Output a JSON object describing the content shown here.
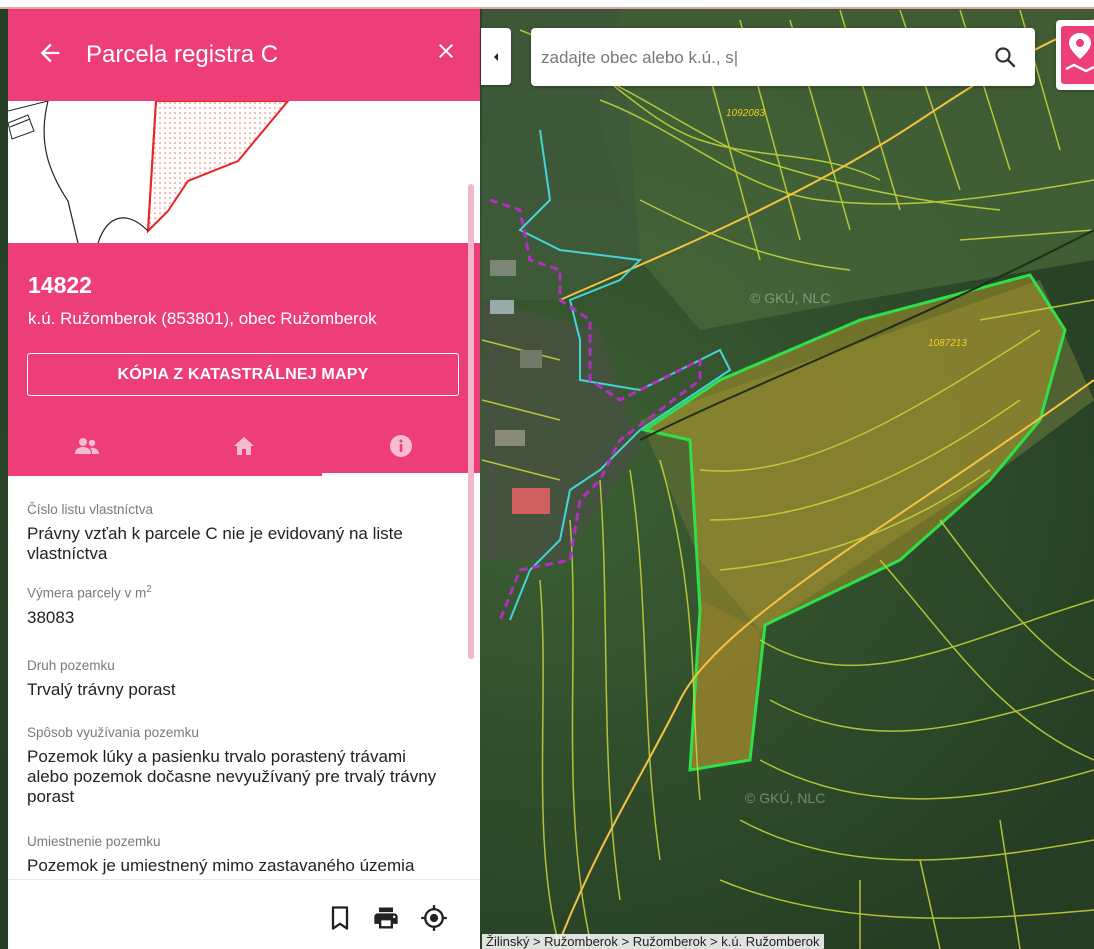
{
  "panel": {
    "title": "Parcela registra C",
    "parcel_number": "14822",
    "location": "k.ú. Ružomberok (853801), obec Ružomberok",
    "copy_button": "KÓPIA Z KATASTRÁLNEJ MAPY",
    "tabs": [
      {
        "icon": "owners-icon",
        "active": false
      },
      {
        "icon": "home-icon",
        "active": false
      },
      {
        "icon": "info-icon",
        "active": true
      }
    ],
    "fields": [
      {
        "label": "Číslo listu vlastníctva",
        "value": "Právny vzťah k parcele C nie je evidovaný na liste vlastníctva"
      },
      {
        "label": "Výmera parcely v m",
        "label_sup": "2",
        "value": "38083"
      },
      {
        "label": "Druh pozemku",
        "value": "Trvalý trávny porast"
      },
      {
        "label": "Spôsob využívania pozemku",
        "value": "Pozemok lúky a pasienku trvalo porastený trávami alebo pozemok dočasne nevyužívaný pre trvalý trávny porast"
      },
      {
        "label": "Umiestnenie pozemku",
        "value": "Pozemok je umiestnený mimo zastavaného územia obce"
      }
    ],
    "footer_icons": [
      "bookmark-icon",
      "print-icon",
      "locate-icon"
    ]
  },
  "search": {
    "placeholder": "zadajte obec alebo k.ú., s|"
  },
  "map": {
    "parcel_labels": [
      "1092083",
      "1087213"
    ],
    "watermark": "© GKÚ, NLC",
    "breadcrumb": [
      "Žilinský",
      "Ružomberok",
      "Ružomberok",
      "k.ú. Ružomberok"
    ],
    "breadcrumb_sep": " > "
  },
  "colors": {
    "accent": "#ee3e7a",
    "parcel_highlight": "#2ee04a",
    "boundary_line": "#c9d83a",
    "road_line": "#f5c242"
  }
}
